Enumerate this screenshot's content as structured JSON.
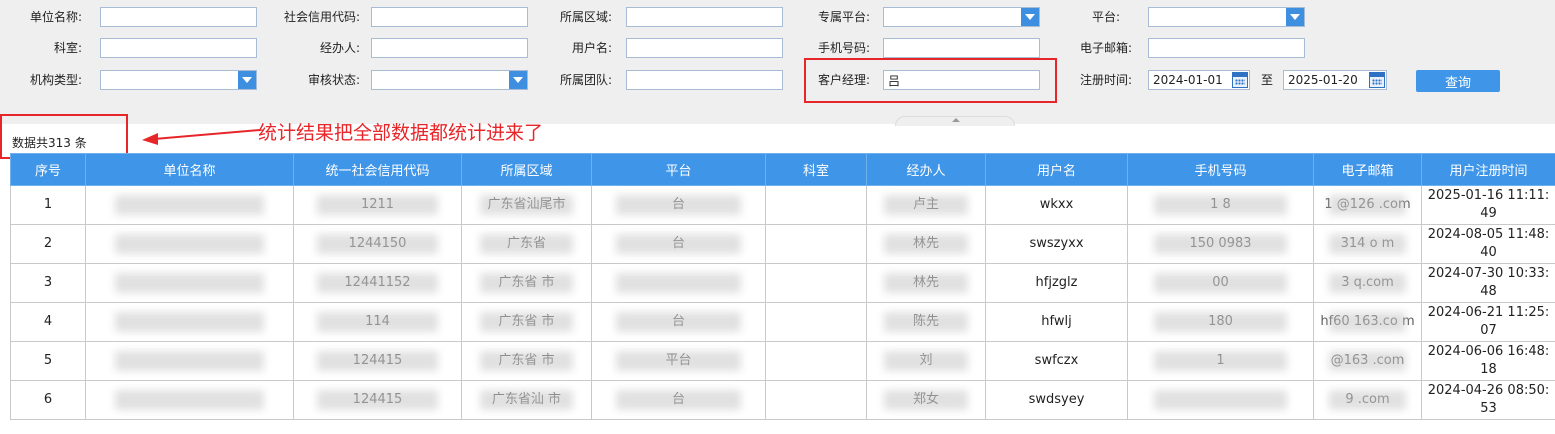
{
  "filters": {
    "unit_name": {
      "label": "单位名称:",
      "value": ""
    },
    "credit_code": {
      "label": "社会信用代码:",
      "value": ""
    },
    "region": {
      "label": "所属区域:",
      "value": ""
    },
    "exclusive_platform": {
      "label": "专属平台:",
      "value": ""
    },
    "platform": {
      "label": "平台:",
      "value": ""
    },
    "department": {
      "label": "科室:",
      "value": ""
    },
    "handler": {
      "label": "经办人:",
      "value": ""
    },
    "username": {
      "label": "用户名:",
      "value": ""
    },
    "phone": {
      "label": "手机号码:",
      "value": ""
    },
    "email": {
      "label": "电子邮箱:",
      "value": ""
    },
    "org_type": {
      "label": "机构类型:",
      "value": ""
    },
    "audit_status": {
      "label": "审核状态:",
      "value": ""
    },
    "team": {
      "label": "所属团队:",
      "value": ""
    },
    "account_manager": {
      "label": "客户经理:",
      "value": "吕"
    },
    "register_time": {
      "label": "注册时间:",
      "start": "2024-01-01",
      "separator": "至",
      "end": "2025-01-20"
    },
    "query_label": "查询"
  },
  "summary": {
    "count_text": "数据共313 条"
  },
  "annotation": {
    "text": "统计结果把全部数据都统计进来了",
    "color": "#e8262a"
  },
  "table": {
    "columns": [
      "序号",
      "单位名称",
      "统一社会信用代码",
      "所属区域",
      "平台",
      "科室",
      "经办人",
      "用户名",
      "手机号码",
      "电子邮箱",
      "用户注册时间"
    ],
    "rows": [
      {
        "no": "1",
        "unit": "",
        "code": "1211",
        "region": "广东省汕尾市",
        "platform": "台",
        "dept": "",
        "handler": "卢主",
        "username": "wkxx",
        "phone": "1 8",
        "email": "1 @126 .com",
        "time": "2025-01-16 11:11:49"
      },
      {
        "no": "2",
        "unit": "",
        "code": "1244150",
        "region": "广东省",
        "platform": "台",
        "dept": "",
        "handler": "林先",
        "username": "swszyxx",
        "phone": "150 0983",
        "email": "314 o m",
        "time": "2024-08-05 11:48:40"
      },
      {
        "no": "3",
        "unit": "",
        "code": "12441152",
        "region": "广东省 市",
        "platform": "",
        "dept": "",
        "handler": "林先",
        "username": "hfjzglz",
        "phone": "00",
        "email": "3 q.com",
        "time": "2024-07-30 10:33:48"
      },
      {
        "no": "4",
        "unit": "",
        "code": "114",
        "region": "广东省 市",
        "platform": "台",
        "dept": "",
        "handler": "陈先",
        "username": "hfwlj",
        "phone": "180",
        "email": "hf60 163.co m",
        "time": "2024-06-21 11:25:07"
      },
      {
        "no": "5",
        "unit": "",
        "code": "124415",
        "region": "广东省 市",
        "platform": "平台",
        "dept": "",
        "handler": "刘",
        "username": "swfczx",
        "phone": "1",
        "email": "@163 .com",
        "time": "2024-06-06 16:48:18"
      },
      {
        "no": "6",
        "unit": "",
        "code": "124415",
        "region": "广东省汕 市",
        "platform": "台",
        "dept": "",
        "handler": "郑女",
        "username": "swdsyey",
        "phone": "",
        "email": "9 .com",
        "time": "2024-04-26 08:50:53"
      }
    ]
  },
  "colors": {
    "header_bg": "#3f95e8",
    "filter_bg": "#efefef",
    "annotation_red": "#e8262a"
  }
}
